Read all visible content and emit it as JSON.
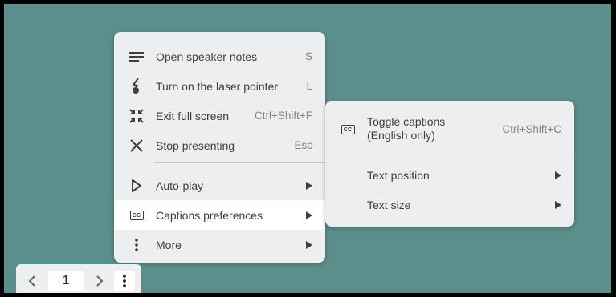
{
  "main_menu": {
    "items": [
      {
        "label": "Open speaker notes",
        "shortcut": "S",
        "icon": "notes-icon"
      },
      {
        "label": "Turn on the laser pointer",
        "shortcut": "L",
        "icon": "laser-pointer-icon"
      },
      {
        "label": "Exit full screen",
        "shortcut": "Ctrl+Shift+F",
        "icon": "exit-fullscreen-icon"
      },
      {
        "label": "Stop presenting",
        "shortcut": "Esc",
        "icon": "close-icon"
      },
      {
        "label": "Auto-play",
        "icon": "play-icon",
        "submenu": true
      },
      {
        "label": "Captions preferences",
        "icon": "closed-captions-icon",
        "submenu": true,
        "highlighted": true
      },
      {
        "label": "More",
        "icon": "more-vert-icon",
        "submenu": true
      }
    ]
  },
  "submenu": {
    "items": [
      {
        "label_line1": "Toggle captions",
        "label_line2": "(English only)",
        "shortcut": "Ctrl+Shift+C",
        "icon": "closed-captions-icon"
      },
      {
        "label": "Text position",
        "submenu": true
      },
      {
        "label": "Text size",
        "submenu": true
      }
    ]
  },
  "toolbar": {
    "page_number": "1",
    "cc_text": "CC"
  },
  "colors": {
    "background": "#5b8f8c",
    "menu": "#eceeef",
    "highlight": "#ffffff",
    "text": "#3c4043",
    "shortcut": "#80868b"
  }
}
